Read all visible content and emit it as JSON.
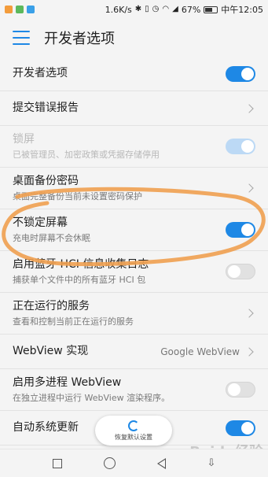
{
  "status_bar": {
    "speed": "1.6K/s",
    "battery_text": "67%",
    "battery_level": 0.67,
    "time": "中午12:05",
    "icons": [
      "app-icon-orange",
      "app-icon-green",
      "app-icon-blue",
      "bluetooth-icon",
      "vibrate-icon",
      "alarm-icon",
      "wifi-icon",
      "signal-icon"
    ]
  },
  "app_bar": {
    "title": "开发者选项"
  },
  "rows": [
    {
      "title": "开发者选项",
      "control": "toggle-on"
    },
    {
      "title": "提交错误报告",
      "control": "chevron"
    },
    {
      "title": "锁屏",
      "subtitle": "已被管理员、加密政策或凭据存储停用",
      "control": "toggle-on-disabled"
    },
    {
      "title": "桌面备份密码",
      "subtitle": "桌面完整备份当前未设置密码保护",
      "control": "chevron"
    },
    {
      "title": "不锁定屏幕",
      "subtitle": "充电时屏幕不会休眠",
      "control": "toggle-on"
    },
    {
      "title": "启用蓝牙 HCI 信息收集日志",
      "subtitle": "捕获单个文件中的所有蓝牙 HCI 包",
      "control": "toggle-off"
    },
    {
      "title": "正在运行的服务",
      "subtitle": "查看和控制当前正在运行的服务",
      "control": "chevron"
    },
    {
      "title": "WebView 实现",
      "value": "Google WebView",
      "control": "chevron"
    },
    {
      "title": "启用多进程 WebView",
      "subtitle": "在独立进程中运行 WebView 渲染程序。",
      "control": "toggle-off"
    },
    {
      "title": "自动系统更新",
      "control": "toggle-on"
    }
  ],
  "floating_button": {
    "label": "恢复默认设置"
  },
  "watermark": "Baidu经验",
  "colors": {
    "accent": "#1e88e5",
    "annotation": "#f0a050"
  }
}
